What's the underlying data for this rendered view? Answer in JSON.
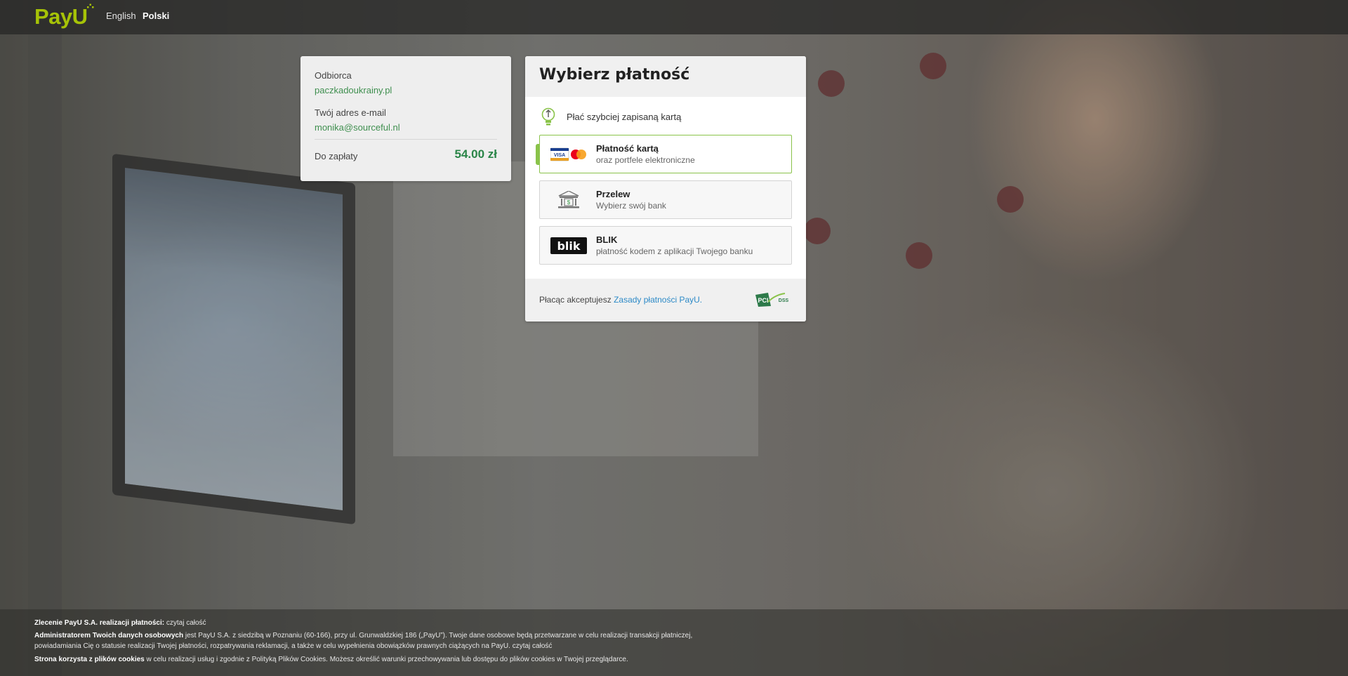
{
  "header": {
    "logo_text": "PayU",
    "languages": [
      {
        "label": "English",
        "active": false
      },
      {
        "label": "Polski",
        "active": true
      }
    ]
  },
  "summary": {
    "recipient_label": "Odbiorca",
    "recipient_value": "paczkadoukrainy.pl",
    "email_label": "Twój adres e-mail",
    "email_value": "monika@sourceful.nl",
    "amount_label": "Do zapłaty",
    "amount_value": "54.00 zł"
  },
  "payment": {
    "title": "Wybierz płatność",
    "saved_card_text": "Płać szybciej zapisaną kartą",
    "options": [
      {
        "name": "Płatność kartą",
        "sub": "oraz portfele elektroniczne",
        "icon": "card-icon",
        "selected": true
      },
      {
        "name": "Przelew",
        "sub": "Wybierz swój bank",
        "icon": "bank-icon",
        "selected": false
      },
      {
        "name": "BLIK",
        "sub": "płatność kodem z aplikacji Twojego banku",
        "icon": "blik-icon",
        "selected": false
      }
    ],
    "footer_text": "Płacąc akceptujesz ",
    "footer_link": "Zasady płatności PayU.",
    "badge_text": "PCI DSS"
  },
  "legal": {
    "line1_bold": "Zlecenie PayU S.A. realizacji płatności:",
    "line1_link": "czytaj całość",
    "line2_bold": "Administratorem Twoich danych osobowych",
    "line2_text": "jest PayU S.A. z siedzibą w Poznaniu (60-166), przy ul. Grunwaldzkiej 186 („PayU”). Twoje dane osobowe będą przetwarzane w celu realizacji transakcji płatniczej,",
    "line3_text": "powiadamiania Cię o statusie realizacji Twojej płatności, rozpatrywania reklamacji, a także w celu wypełnienia obowiązków prawnych ciążących na PayU.",
    "line3_link": "czytaj całość",
    "line4_bold": "Strona korzysta z plików cookies",
    "line4_text": "w celu realizacji usług i zgodnie z Polityką Plików Cookies. Możesz określić warunki przechowywania lub dostępu do plików cookies w Twojej przeglądarce."
  },
  "colors": {
    "brand_green": "#a6c307",
    "accent_green": "#8ac34a",
    "amount_green": "#2a8548",
    "link_blue": "#2d8ac7"
  }
}
